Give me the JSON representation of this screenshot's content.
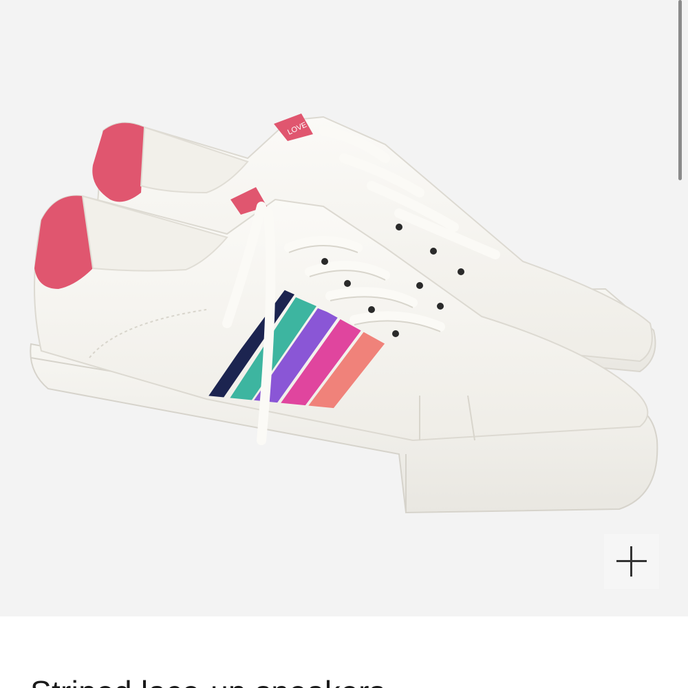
{
  "product": {
    "title": "Striped lace-up sneakers",
    "image_alt": "Striped lace-up sneakers",
    "heel_tab_text": "LOVE"
  },
  "zoom": {
    "icon": "plus-icon",
    "label": "+"
  },
  "colors": {
    "page_background": "#ffffff",
    "image_background": "#f3f3f3",
    "sneaker_body": "#f7f6f2",
    "heel_pink": "#e0566f",
    "stripe_navy": "#1c2450",
    "stripe_teal": "#3db5a0",
    "stripe_purple": "#8a56d6",
    "stripe_magenta": "#e0459e",
    "stripe_coral": "#f0827a"
  }
}
